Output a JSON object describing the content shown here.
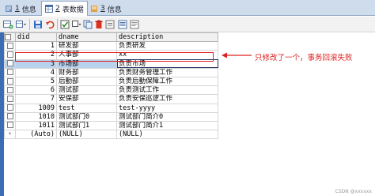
{
  "tabs": [
    {
      "num": "1",
      "label": "信息",
      "active": false
    },
    {
      "num": "2",
      "label": "表数据",
      "active": true
    },
    {
      "num": "3",
      "label": "信息",
      "active": false
    }
  ],
  "toolbar": {
    "icons": [
      "grid-add-icon",
      "grid-add-dropdown-icon",
      "save-icon",
      "undo-icon",
      "checkbox-icon",
      "checkbox-dropdown-icon",
      "copy-icon",
      "delete-icon",
      "export-icon",
      "form-view-icon",
      "text-view-icon"
    ]
  },
  "grid": {
    "columns": [
      "did",
      "dname",
      "description"
    ],
    "rows": [
      {
        "id": "1",
        "dname": "研发部",
        "description": "负责研发"
      },
      {
        "id": "2",
        "dname": "人事部",
        "description": "xx"
      },
      {
        "id": "3",
        "dname": "市场部",
        "description": "负责市场"
      },
      {
        "id": "4",
        "dname": "财务部",
        "description": "负责财务管理工作"
      },
      {
        "id": "5",
        "dname": "后勤部",
        "description": "负责后勤保障工作"
      },
      {
        "id": "6",
        "dname": "测试部",
        "description": "负责测试工作"
      },
      {
        "id": "7",
        "dname": "安保部",
        "description": "负责安保巡逻工作"
      },
      {
        "id": "1009",
        "dname": "test",
        "description": "test-yyyy"
      },
      {
        "id": "1010",
        "dname": "测试部门0",
        "description": "测试部门简介0"
      },
      {
        "id": "1011",
        "dname": "测试部门1",
        "description": "测试部门简介1"
      }
    ],
    "new_row": {
      "marker": "*",
      "id": "(Auto)",
      "dname": "(NULL)",
      "description": "(NULL)"
    }
  },
  "annotation": {
    "text": "只修改了一个，事务回滚失败",
    "color": "#e02020"
  },
  "watermark": "CSDN @xxxxxx",
  "colors": {
    "selected_row": "#b9d3ee",
    "left_strip": "#3c6cb4",
    "tabbar": "#cfdcec"
  }
}
